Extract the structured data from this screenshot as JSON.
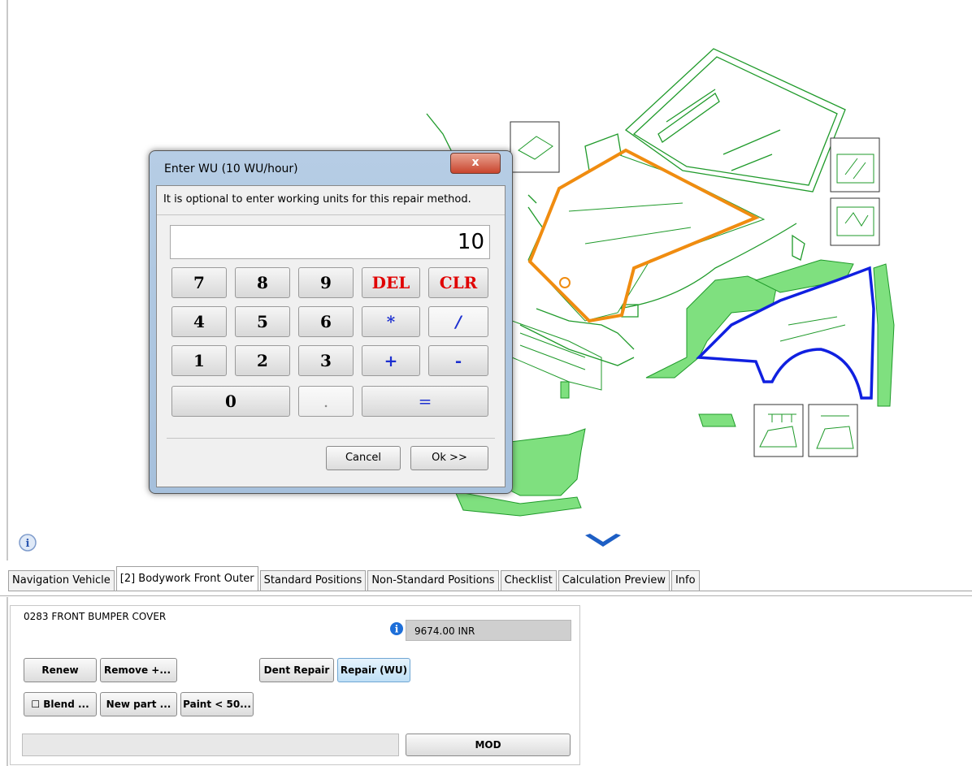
{
  "dialog": {
    "title": "Enter WU (10 WU/hour)",
    "close_label": "x",
    "message": "It is optional to enter working units for this repair method.",
    "display_value": "10",
    "keys": {
      "k7": "7",
      "k8": "8",
      "k9": "9",
      "del": "DEL",
      "clr": "CLR",
      "k4": "4",
      "k5": "5",
      "k6": "6",
      "mul": "*",
      "div": "/",
      "k1": "1",
      "k2": "2",
      "k3": "3",
      "add": "+",
      "sub": "-",
      "k0": "0",
      "dot": ".",
      "eq": "="
    },
    "cancel_label": "Cancel",
    "ok_label": "Ok >>"
  },
  "tabs": [
    {
      "label": "Navigation Vehicle"
    },
    {
      "label": "[2] Bodywork Front Outer",
      "active": true
    },
    {
      "label": "Standard Positions"
    },
    {
      "label": "Non-Standard Positions"
    },
    {
      "label": "Checklist"
    },
    {
      "label": "Calculation Preview"
    },
    {
      "label": "Info"
    }
  ],
  "part": {
    "title": "0283 FRONT BUMPER COVER",
    "price": "9674.00 INR"
  },
  "buttons": {
    "renew": "Renew",
    "remove": "Remove +...",
    "dent_repair": "Dent Repair",
    "repair_wu": "Repair (WU)",
    "blend": "☐ Blend ...",
    "new_part": "New part ...",
    "paint": "Paint < 50...",
    "mod": "MOD"
  },
  "colors": {
    "part_outline": "#1f9a2a",
    "part_fill": "#7fe07f",
    "selected_hood": "#f08c10",
    "selected_fender": "#1020e0",
    "active_button": "#bfdff6"
  }
}
